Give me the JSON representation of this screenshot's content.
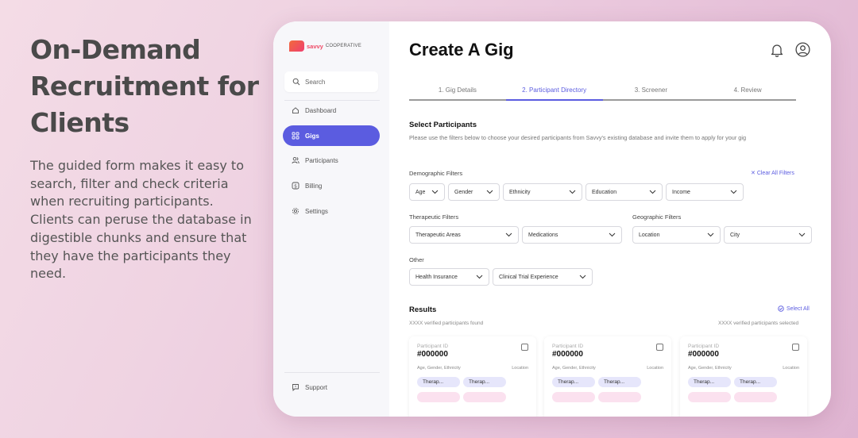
{
  "hero": {
    "title": "On-Demand Recruitment for Clients",
    "body": "The guided form makes it easy to search, filter and check criteria when recruiting participants. Clients can peruse the database in digestible chunks and ensure that they have the participants they need."
  },
  "logo": {
    "brand": "savvy",
    "suffix": "COOPERATIVE",
    "mark": "TM"
  },
  "sidebar": {
    "search_placeholder": "Search",
    "items": [
      {
        "label": "Dashboard",
        "icon": "home-icon",
        "active": false
      },
      {
        "label": "Gigs",
        "icon": "grid-icon",
        "active": true
      },
      {
        "label": "Participants",
        "icon": "users-icon",
        "active": false
      },
      {
        "label": "Billing",
        "icon": "dollar-icon",
        "active": false
      },
      {
        "label": "Settings",
        "icon": "gear-icon",
        "active": false
      }
    ],
    "support_label": "Support"
  },
  "header": {
    "title": "Create A Gig",
    "icons": [
      "bell-icon",
      "user-icon"
    ]
  },
  "steps": [
    {
      "label": "1. Gig Details",
      "active": false
    },
    {
      "label": "2. Participant Directory",
      "active": true
    },
    {
      "label": "3. Screener",
      "active": false
    },
    {
      "label": "4. Review",
      "active": false
    }
  ],
  "select_participants": {
    "title": "Select Participants",
    "description": "Please use the filters below to choose your desired participants from Savvy's existing database and invite them to apply for your gig"
  },
  "filters": {
    "demographic_label": "Demographic Filters",
    "clear_all": "Clear All Filters",
    "demographic": [
      "Age",
      "Gender",
      "Ethnicity",
      "Education",
      "Income"
    ],
    "therapeutic_label": "Therapeutic Filters",
    "therapeutic": [
      "Therapeutic Areas",
      "Medications"
    ],
    "geographic_label": "Geographic Filters",
    "geographic": [
      "Location",
      "City"
    ],
    "other_label": "Other",
    "other": [
      "Health Insurance",
      "Clinical Trial Experience"
    ]
  },
  "results": {
    "title": "Results",
    "select_all": "Select All",
    "found": "XXXX verified participants found",
    "selected": "XXXX verified participants selected",
    "cards": [
      {
        "id_label": "Participant ID",
        "id": "#000000",
        "meta": "Age, Gender, Ethnicity",
        "location": "Location",
        "tags": [
          "Therap...",
          "Therap..."
        ]
      },
      {
        "id_label": "Participant ID",
        "id": "#000000",
        "meta": "Age, Gender, Ethnicity",
        "location": "Location",
        "tags": [
          "Therap...",
          "Therap..."
        ]
      },
      {
        "id_label": "Participant ID",
        "id": "#000000",
        "meta": "Age, Gender, Ethnicity",
        "location": "Location",
        "tags": [
          "Therap...",
          "Therap..."
        ]
      }
    ]
  },
  "colors": {
    "accent": "#5b5ce0",
    "brand": "#ef4a66"
  }
}
